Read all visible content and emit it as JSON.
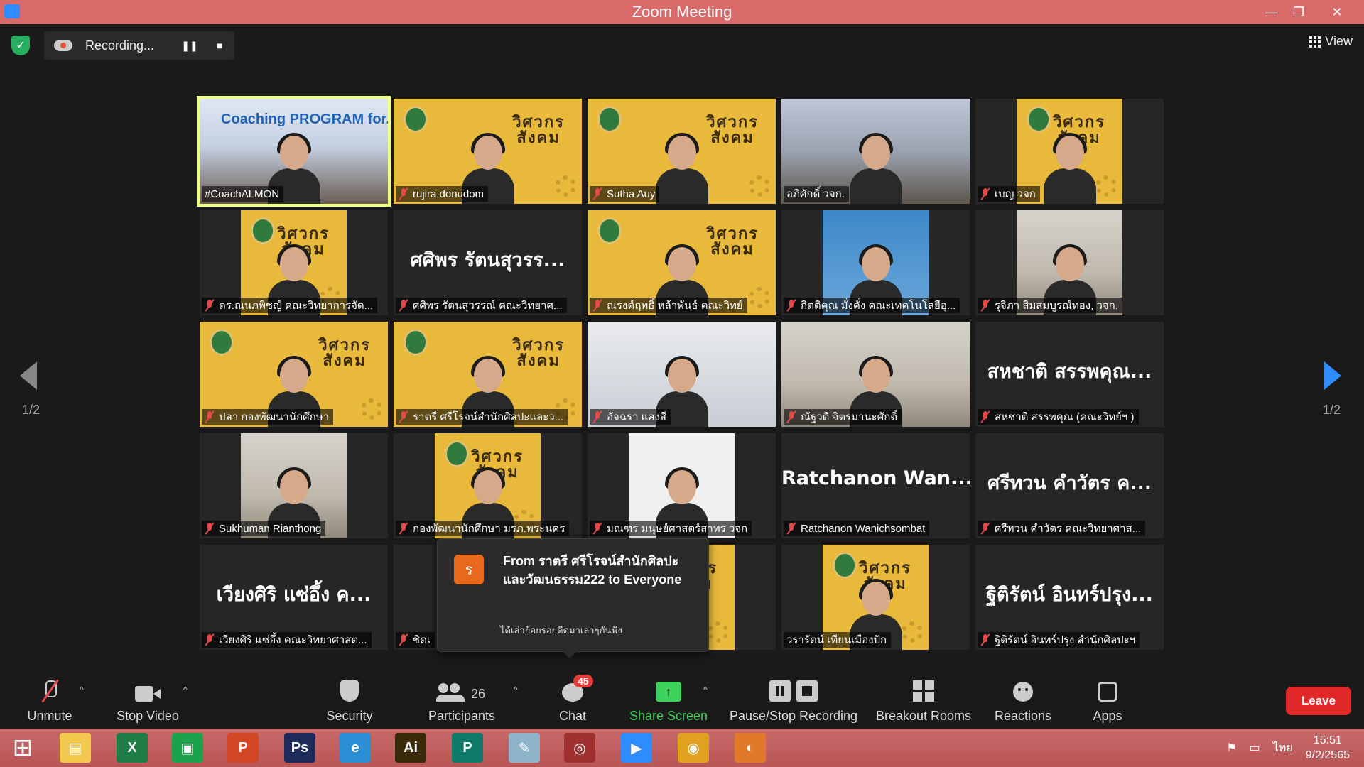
{
  "window": {
    "title": "Zoom Meeting",
    "minimize": "—",
    "restore": "❐",
    "close": "✕"
  },
  "topbar": {
    "recording_label": "Recording...",
    "pause_icon": "❚❚",
    "stop_icon": "■",
    "view_label": "View"
  },
  "paging": {
    "left_page": "1/2",
    "right_page": "1/2"
  },
  "participants": [
    {
      "name": "#CoachALMON",
      "muted": false,
      "bg": "coach",
      "active": true,
      "overlay": "Coaching PROGRAM for...er"
    },
    {
      "name": "rujira donudom",
      "muted": true,
      "bg": "yellow"
    },
    {
      "name": "Sutha Auy",
      "muted": true,
      "bg": "yellow"
    },
    {
      "name": "อภิศักดิ์ วจก.",
      "muted": false,
      "bg": "gallery"
    },
    {
      "name": "เบญ วจก",
      "muted": true,
      "bg": "yellow-narrow"
    },
    {
      "name": "ดร.ณนภพิชญ์ คณะวิทยาการจัด...",
      "muted": true,
      "bg": "yellow-narrow"
    },
    {
      "name": "ศศิพร รัตนสุวรรณ์ คณะวิทยาศ...",
      "muted": true,
      "bg": "none",
      "big": "ศศิพร รัตนสุวรร..."
    },
    {
      "name": "ณรงค์ฤทธิ์ หล้าพันธ์ คณะวิทย์",
      "muted": true,
      "bg": "yellow"
    },
    {
      "name": "กิตติคุณ มั่งคั่ง คณะเทคโนโลยีอุ...",
      "muted": true,
      "bg": "cartoon-narrow"
    },
    {
      "name": "รุจิภา สิมสมบูรณ์ทอง, วจก.",
      "muted": true,
      "bg": "office-narrow"
    },
    {
      "name": "ปลา กองพัฒนานักศึกษา",
      "muted": true,
      "bg": "yellow"
    },
    {
      "name": "ราตรี   ศรีโรจน์สำนักศิลปะและว...",
      "muted": true,
      "bg": "yellow"
    },
    {
      "name": "อัจฉรา แสงสี",
      "muted": true,
      "bg": "room"
    },
    {
      "name": "ณัฐวดี จิตรมานะศักดิ์",
      "muted": true,
      "bg": "office"
    },
    {
      "name": "สหชาติ สรรพคุณ (คณะวิทย์ฯ )",
      "muted": true,
      "bg": "none",
      "big": "สหชาติ สรรพคุณ..."
    },
    {
      "name": "Sukhuman Rianthong",
      "muted": true,
      "bg": "office-narrow"
    },
    {
      "name": "กองพัฒนานักศึกษา มรภ.พระนคร",
      "muted": true,
      "bg": "yellow-narrow"
    },
    {
      "name": "มณฑร มนุษย์ศาสตร์สาทร วจก",
      "muted": true,
      "bg": "white-narrow"
    },
    {
      "name": "Ratchanon Wanichsombat",
      "muted": true,
      "bg": "none",
      "big": "Ratchanon  Wan..."
    },
    {
      "name": "ศรีทวน  คำวัตร คณะวิทยาศาส...",
      "muted": true,
      "bg": "none",
      "big": "ศรีทวน  คำวัตร ค..."
    },
    {
      "name": "เวียงศิริ  แซ่อึ้ง  คณะวิทยาศาสต...",
      "muted": true,
      "bg": "none",
      "big": "เวียงศิริ  แซ่อึ้ง  ค..."
    },
    {
      "name": "ชิดเ",
      "muted": true,
      "bg": "none",
      "big": "ชิดเ"
    },
    {
      "name": "",
      "muted": false,
      "bg": "yellow-narrow"
    },
    {
      "name": "วรารัตน์ เทียนเมืองปัก",
      "muted": false,
      "bg": "yellow-narrow"
    },
    {
      "name": "ฐิติรัตน์ อินทร์ปรุง สำนักศิลปะฯ",
      "muted": true,
      "bg": "none",
      "big": "ฐิติรัตน์ อินทร์ปรุง..."
    }
  ],
  "brand_text": "วิศวกร\nสังคม",
  "chat_toast": {
    "avatar_letter": "ร",
    "from": "From ราตรี  ศรีโรจน์สำนักศิลปะและวัฒนธรรม222 to Everyone",
    "message": "ได้เล่าย้อยรอยดีดมาเล่าๆกันฟัง"
  },
  "toolbar": {
    "unmute": "Unmute",
    "stop_video": "Stop Video",
    "security": "Security",
    "participants": "Participants",
    "participants_count": "26",
    "chat": "Chat",
    "chat_badge": "45",
    "share_screen": "Share Screen",
    "share_arrow": "↑",
    "pause_stop_recording": "Pause/Stop Recording",
    "breakout_rooms": "Breakout Rooms",
    "reactions": "Reactions",
    "apps": "Apps",
    "leave": "Leave",
    "caret": "^"
  },
  "taskbar": {
    "apps": [
      {
        "name": "windows-start",
        "label": "⊞",
        "color": "#ffffff"
      },
      {
        "name": "file-explorer",
        "label": "▤",
        "color": "#f2c94c"
      },
      {
        "name": "excel",
        "label": "X",
        "color": "#1e7e45"
      },
      {
        "name": "store",
        "label": "▣",
        "color": "#1aa34a"
      },
      {
        "name": "powerpoint",
        "label": "P",
        "color": "#d24726"
      },
      {
        "name": "photoshop",
        "label": "Ps",
        "color": "#1e2b5a"
      },
      {
        "name": "internet-explorer",
        "label": "e",
        "color": "#2b8fd6"
      },
      {
        "name": "illustrator",
        "label": "Ai",
        "color": "#3a2a0a"
      },
      {
        "name": "publisher",
        "label": "P",
        "color": "#0f7a6a"
      },
      {
        "name": "notes",
        "label": "✎",
        "color": "#8fb3c9"
      },
      {
        "name": "photoscape",
        "label": "◎",
        "color": "#a03030"
      },
      {
        "name": "zoom",
        "label": "▶",
        "color": "#2d8cff"
      },
      {
        "name": "chrome",
        "label": "◉",
        "color": "#e0a020"
      },
      {
        "name": "photos",
        "label": "◐",
        "color": "#e07a2a"
      }
    ],
    "language": "ไทย",
    "time": "15:51",
    "date": "9/2/2565"
  }
}
